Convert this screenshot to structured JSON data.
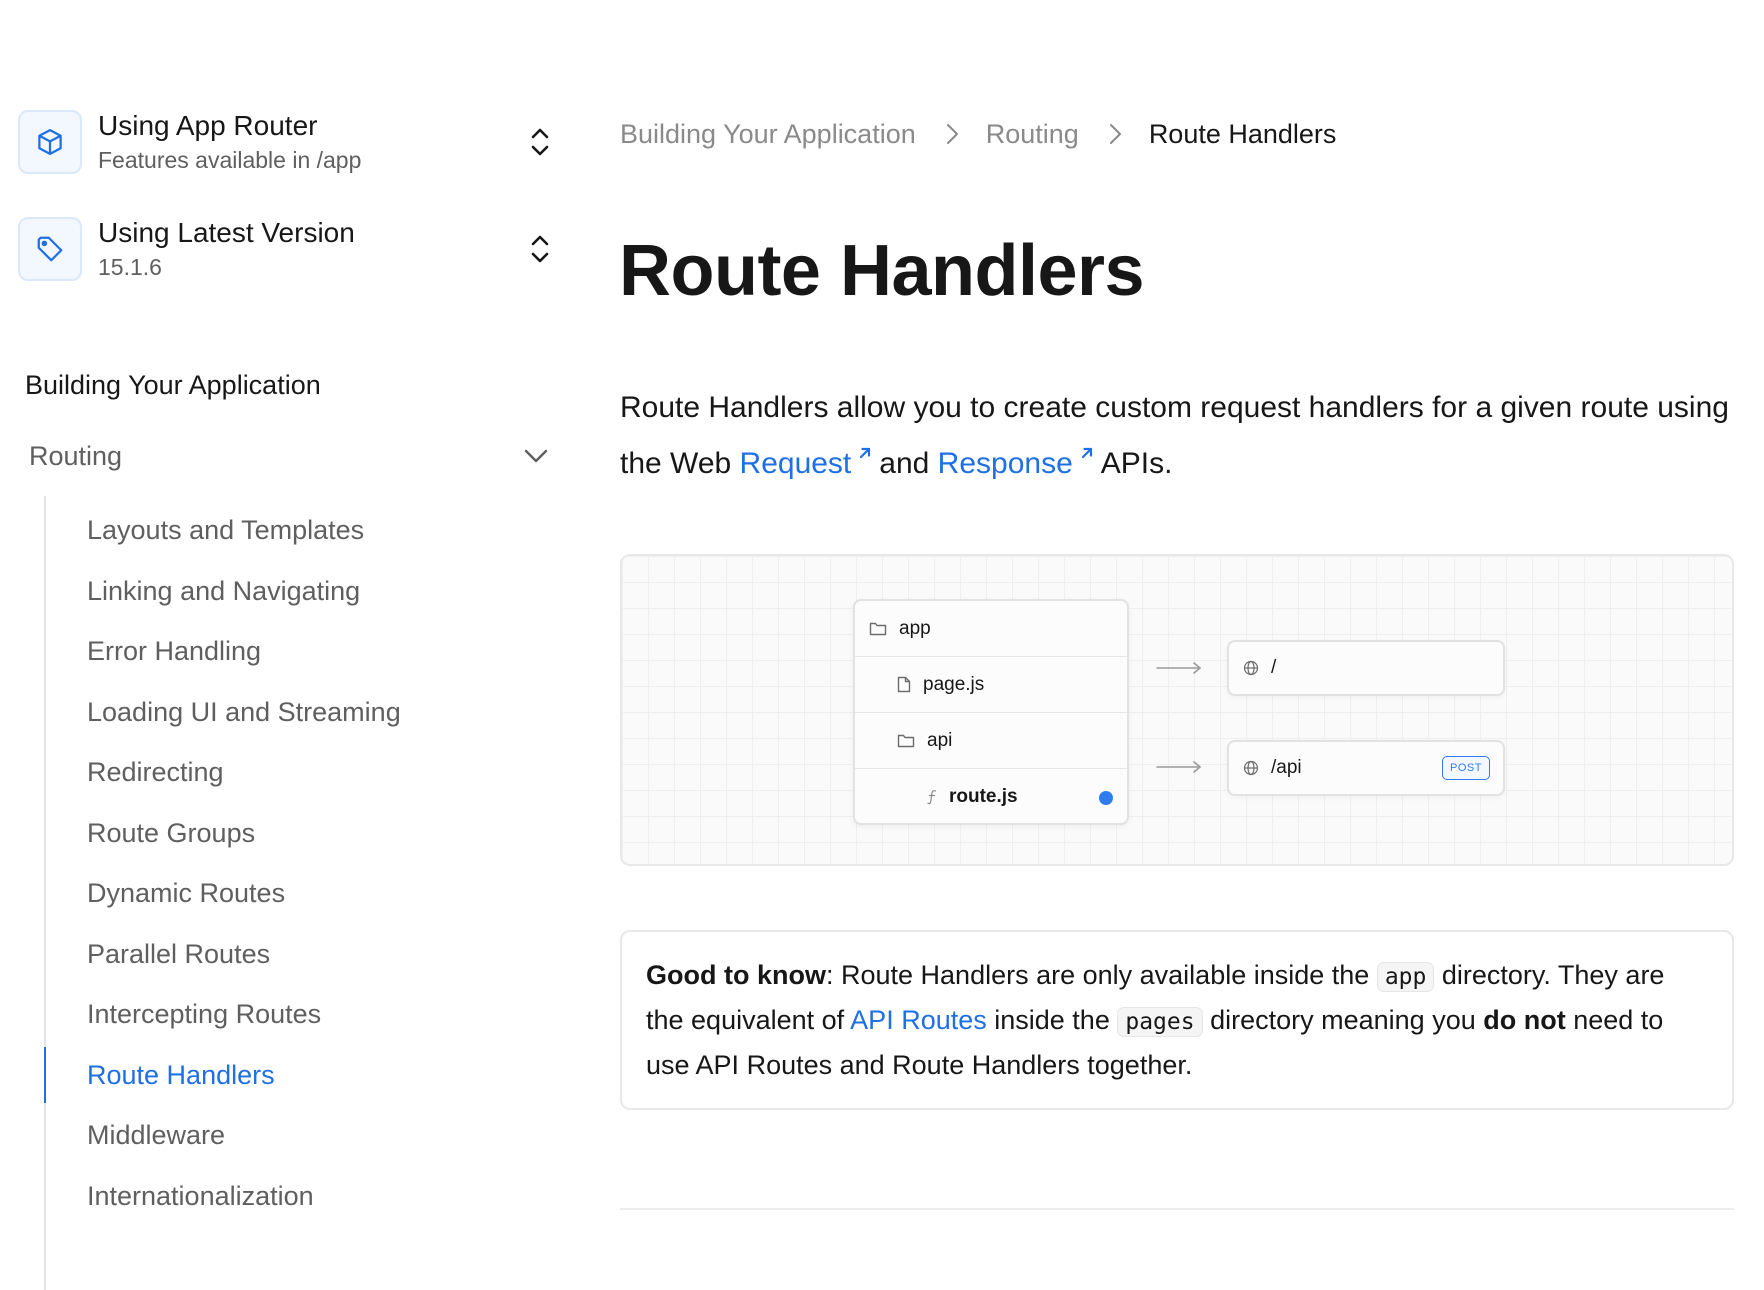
{
  "sidebar": {
    "router_switcher": {
      "title": "Using App Router",
      "subtitle": "Features available in /app"
    },
    "version_switcher": {
      "title": "Using Latest Version",
      "subtitle": "15.1.6"
    },
    "section_heading": "Building Your Application",
    "group_label": "Routing",
    "items": [
      {
        "label": "Layouts and Templates"
      },
      {
        "label": "Linking and Navigating"
      },
      {
        "label": "Error Handling"
      },
      {
        "label": "Loading UI and Streaming"
      },
      {
        "label": "Redirecting"
      },
      {
        "label": "Route Groups"
      },
      {
        "label": "Dynamic Routes"
      },
      {
        "label": "Parallel Routes"
      },
      {
        "label": "Intercepting Routes"
      },
      {
        "label": "Route Handlers",
        "active": true
      },
      {
        "label": "Middleware"
      },
      {
        "label": "Internationalization"
      }
    ]
  },
  "breadcrumb": [
    "Building Your Application",
    "Routing",
    "Route Handlers"
  ],
  "page": {
    "title": "Route Handlers",
    "intro": {
      "text_1": "Route Handlers allow you to create custom request handlers for a given route using the Web ",
      "link_request": "Request",
      "text_2": "and ",
      "link_response": "Response",
      "text_3": "APIs."
    }
  },
  "diagram": {
    "tree": [
      {
        "name": "app",
        "type": "folder",
        "depth": 0
      },
      {
        "name": "page.js",
        "type": "file",
        "depth": 1
      },
      {
        "name": "api",
        "type": "folder",
        "depth": 1
      },
      {
        "name": "route.js",
        "type": "function",
        "depth": 2,
        "highlighted": true
      }
    ],
    "routes": [
      {
        "path": "/"
      },
      {
        "path": "/api",
        "badge": "POST"
      }
    ]
  },
  "callout": {
    "label": "Good to know",
    "t1": ": Route Handlers are only available inside the ",
    "code_app": "app",
    "t2": " directory. They are the equivalent of ",
    "link_api_routes": "API Routes",
    "t3": " inside the ",
    "code_pages": "pages",
    "t4": " directory meaning you ",
    "bold_do_not": "do not",
    "t5": " need to use API Routes and Route Handlers together."
  },
  "colors": {
    "accent": "#1f6fe5",
    "muted_text": "#5f5f5f",
    "breadcrumb_muted": "#8a8a8a"
  },
  "icons": {
    "router_switcher": "cube-icon",
    "version_switcher": "tag-icon",
    "switcher_toggle": "chevron-up-down-icon",
    "group_toggle": "chevron-down-icon",
    "breadcrumb_separator": "chevron-right-icon",
    "external_link": "arrow-up-right-icon"
  }
}
